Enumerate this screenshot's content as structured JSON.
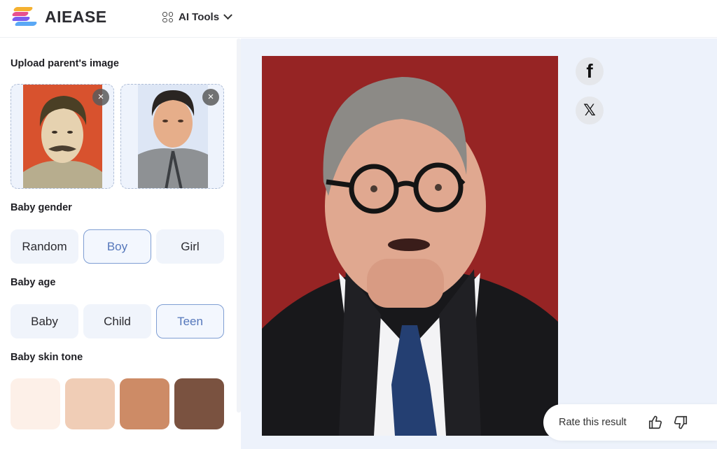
{
  "header": {
    "brand": "AIEASE",
    "logo_colors": [
      "#f5b130",
      "#e8508f",
      "#7b5cf0",
      "#5aa8f5"
    ],
    "tools_menu": {
      "label": "AI Tools",
      "icon": "grid-icon",
      "caret": "chevron-down-icon"
    }
  },
  "sidebar": {
    "upload_title": "Upload parent's image",
    "parents": [
      {
        "name": "parent-image-1",
        "bg": "#d8522e",
        "remove_icon": "×"
      },
      {
        "name": "parent-image-2",
        "bg": "#dde6f5",
        "remove_icon": "×"
      }
    ],
    "gender": {
      "title": "Baby gender",
      "options": [
        "Random",
        "Boy",
        "Girl"
      ],
      "selected": "Boy"
    },
    "age": {
      "title": "Baby age",
      "options": [
        "Baby",
        "Child",
        "Teen"
      ],
      "selected": "Teen"
    },
    "skin_tone": {
      "title": "Baby skin tone",
      "swatches": [
        "#fdf0e8",
        "#f0cdb6",
        "#cd8b66",
        "#7a5240"
      ]
    }
  },
  "result": {
    "background": "#962424",
    "share": [
      {
        "name": "facebook",
        "glyph": "f"
      },
      {
        "name": "x",
        "glyph": "𝕏"
      }
    ],
    "rating": {
      "label": "Rate this result",
      "up": "thumbs-up-icon",
      "down": "thumbs-down-icon"
    }
  },
  "colors": {
    "accent": "#5577bb",
    "accent_border": "#7f9ed3",
    "panel_bg": "#edf2fb"
  }
}
